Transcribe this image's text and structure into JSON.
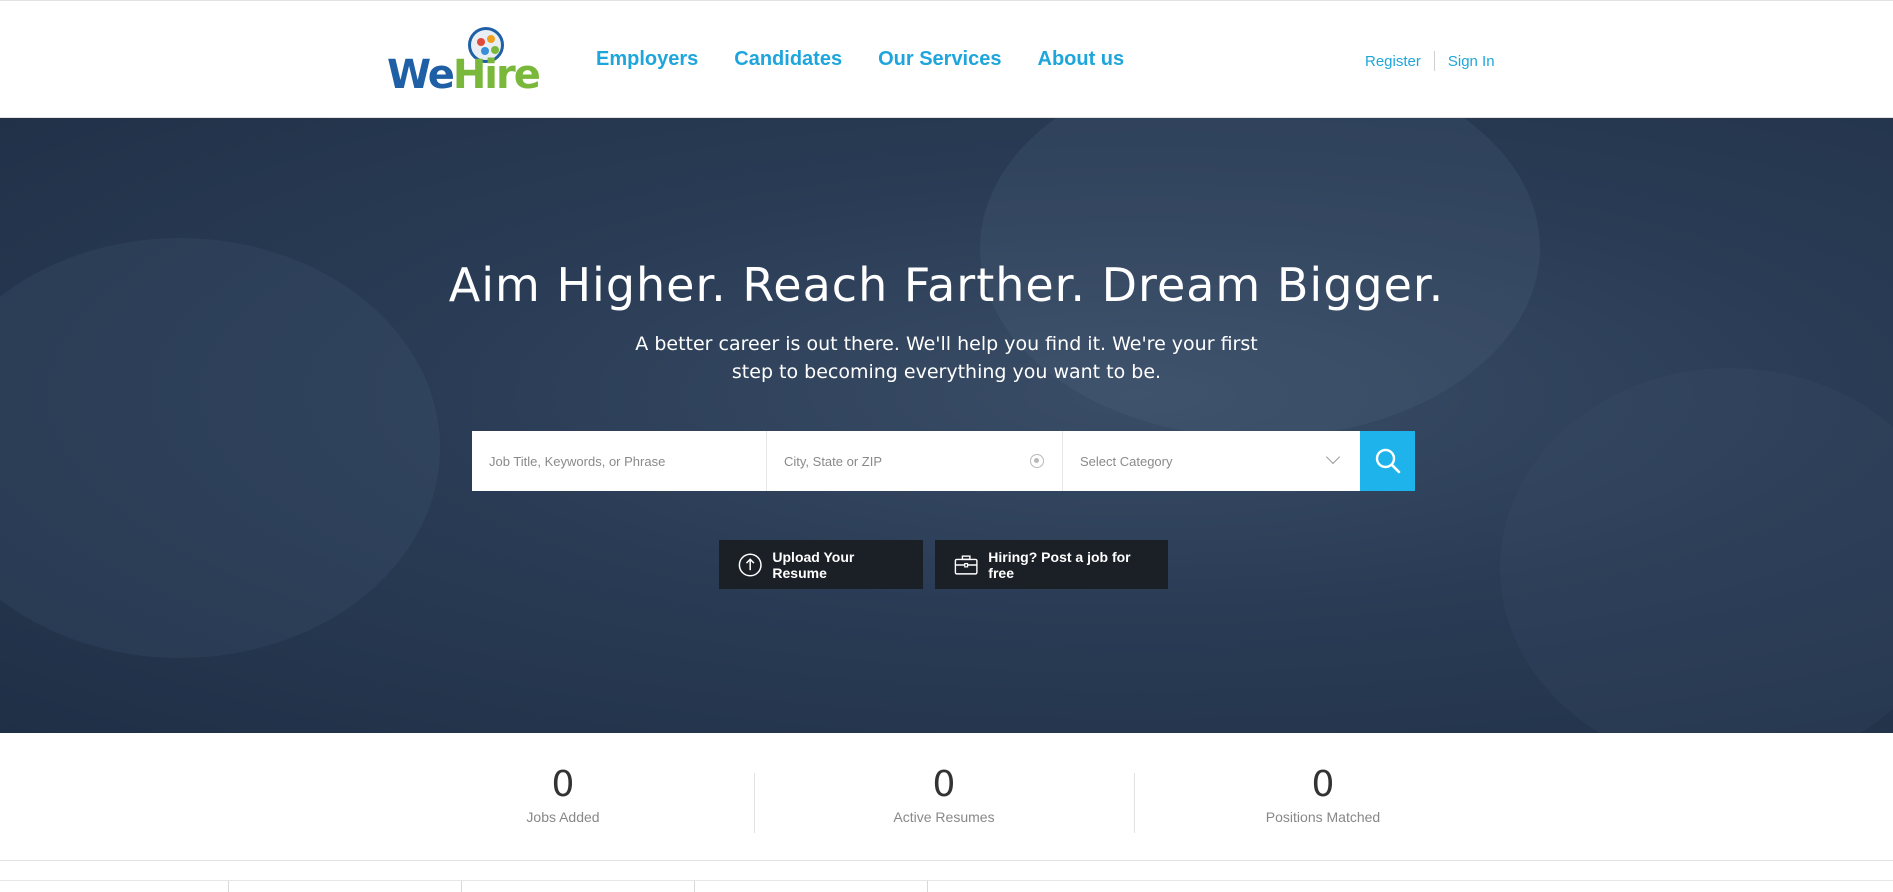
{
  "brand": {
    "logo_we": "We",
    "logo_hire": "Hire"
  },
  "nav": {
    "items": [
      {
        "label": "Employers"
      },
      {
        "label": "Candidates"
      },
      {
        "label": "Our Services"
      },
      {
        "label": "About us"
      }
    ]
  },
  "auth": {
    "register": "Register",
    "signin": "Sign In"
  },
  "hero": {
    "title": "Aim Higher. Reach Farther. Dream Bigger.",
    "subtitle": "A better career is out there. We'll help you find it. We're your first step to becoming everything you want to be."
  },
  "search": {
    "keywords_placeholder": "Job Title, Keywords, or Phrase",
    "location_placeholder": "City, State or ZIP",
    "category_selected": "Select Category"
  },
  "actions": {
    "upload": "Upload Your Resume",
    "post": "Hiring? Post a job for free"
  },
  "stats": [
    {
      "value": "0",
      "label": "Jobs Added"
    },
    {
      "value": "0",
      "label": "Active Resumes"
    },
    {
      "value": "0",
      "label": "Positions Matched"
    }
  ],
  "colors": {
    "accent": "#1ea6dc",
    "search_button": "#1eb3ea",
    "action_bg": "#1b1f26",
    "logo_blue": "#1e5fa6",
    "logo_green": "#7ab83c"
  }
}
